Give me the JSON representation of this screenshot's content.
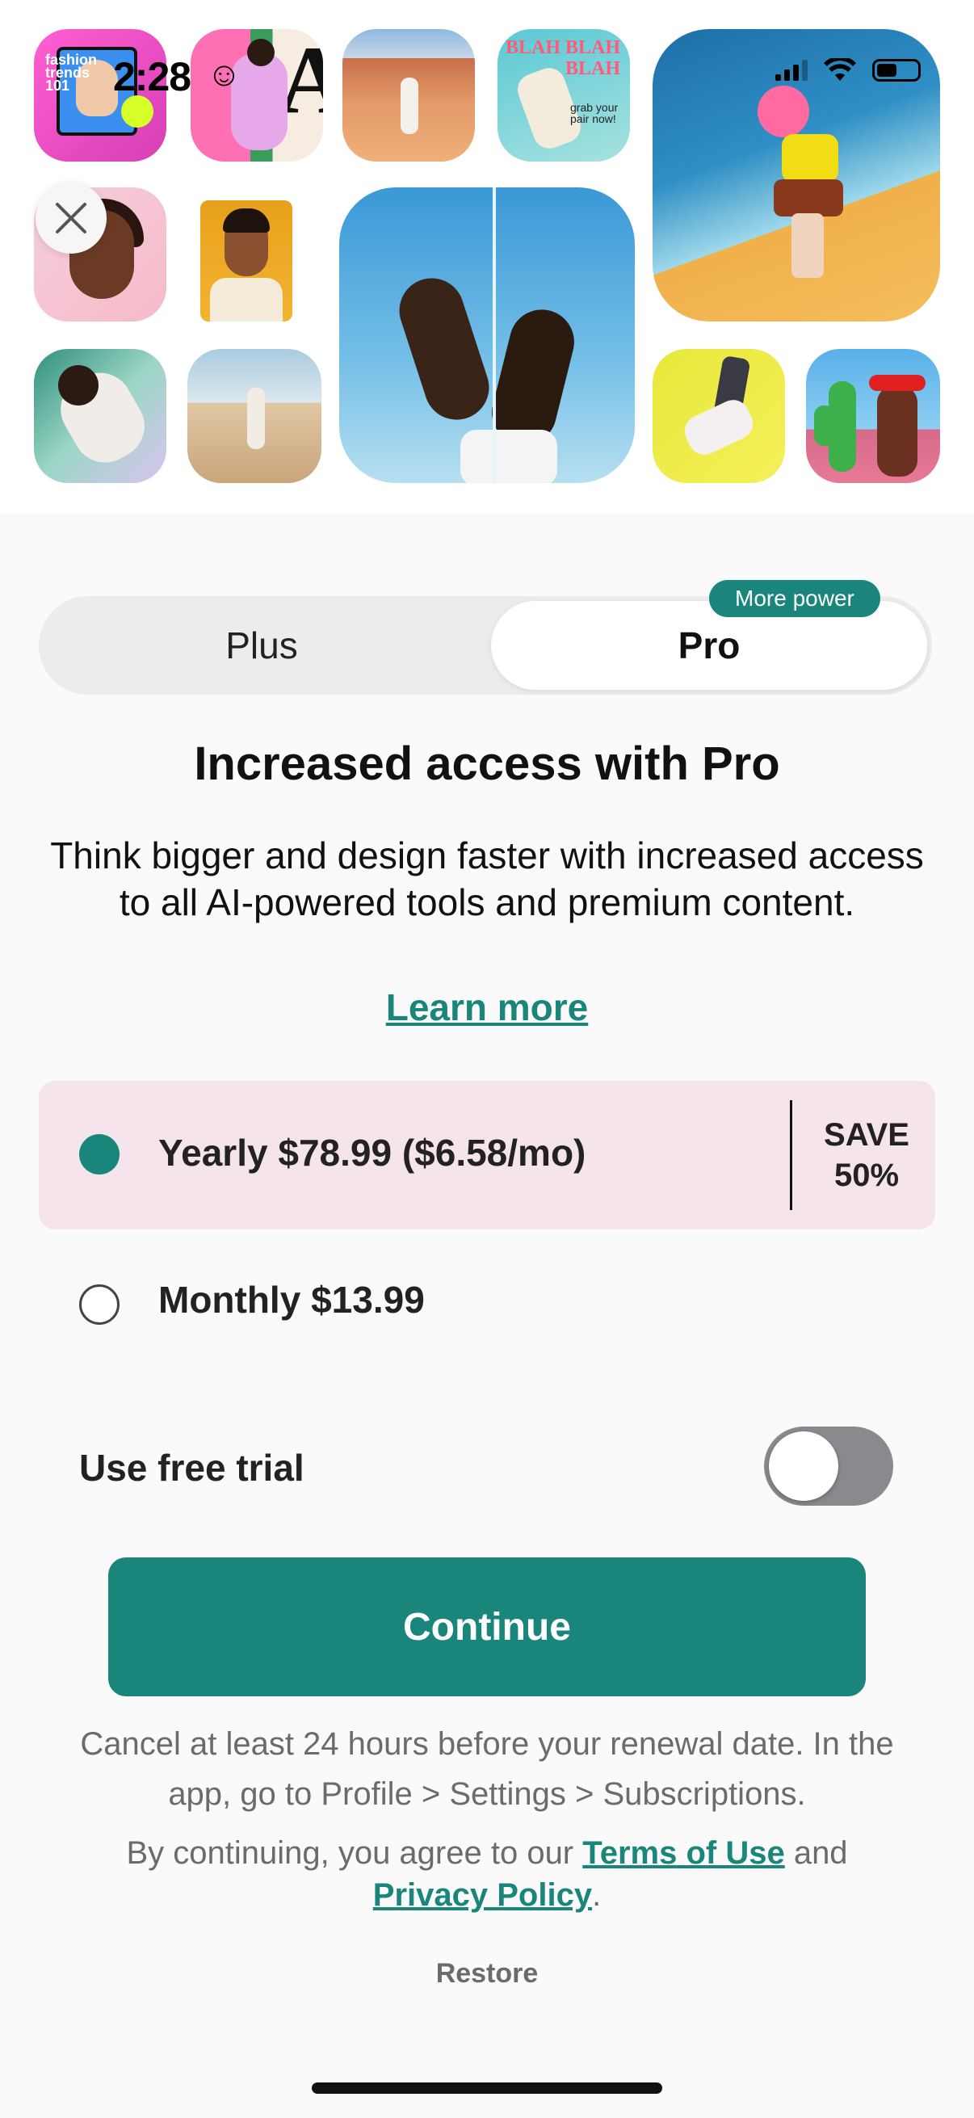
{
  "status_bar": {
    "time": "2:28",
    "smiley": "☺"
  },
  "collage": {
    "tile_fashion_text": "fashion trends 101",
    "tile_blah_text": "BLAH BLAH BLAH",
    "tile_grab_text": "grab your pair now!",
    "tile_letter": "A"
  },
  "close": {
    "icon": "close-icon"
  },
  "plan_tabs": {
    "plus_label": "Plus",
    "pro_label": "Pro",
    "pro_badge": "More power",
    "selected": "Pro"
  },
  "headline": "Increased access with Pro",
  "description": "Think bigger and design faster with increased access to all AI-powered tools and premium content.",
  "learn_more": "Learn more",
  "options": {
    "yearly_label": "Yearly $78.99 ($6.58/mo)",
    "yearly_save_line1": "SAVE",
    "yearly_save_line2": "50%",
    "monthly_label": "Monthly $13.99",
    "selected": "yearly"
  },
  "trial": {
    "label": "Use free trial",
    "enabled": false
  },
  "continue_label": "Continue",
  "footer": {
    "cancel_note": "Cancel at least 24 hours before your renewal date. In the app, go to Profile > Settings > Subscriptions.",
    "agree_prefix": "By continuing, you agree to our ",
    "terms_link": "Terms of Use",
    "agree_and": " and ",
    "privacy_link": "Privacy Policy",
    "agree_suffix": ".",
    "restore": "Restore"
  },
  "colors": {
    "accent": "#1a857a",
    "selected_option_bg": "#f5e4ec",
    "toggle_off": "#8a8a8e"
  }
}
